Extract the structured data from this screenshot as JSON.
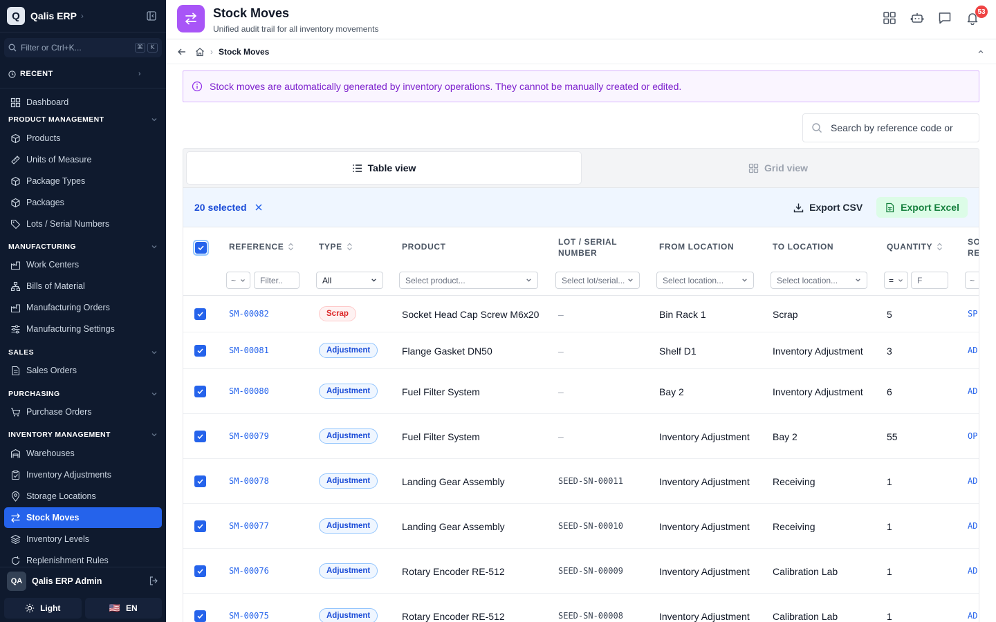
{
  "sidebar": {
    "brand": "Qalis ERP",
    "logo_letter": "Q",
    "search_placeholder": "Filter or Ctrl+K...",
    "kbd": [
      "⌘",
      "K"
    ],
    "recent_label": "RECENT",
    "dashboard": "Dashboard",
    "sections": {
      "product": "PRODUCT MANAGEMENT",
      "manufacturing": "MANUFACTURING",
      "sales": "SALES",
      "purchasing": "PURCHASING",
      "inventory": "INVENTORY MANAGEMENT"
    },
    "items": {
      "products": "Products",
      "uom": "Units of Measure",
      "package_types": "Package Types",
      "packages": "Packages",
      "lots": "Lots / Serial Numbers",
      "work_centers": "Work Centers",
      "bom": "Bills of Material",
      "mo": "Manufacturing Orders",
      "mfg_settings": "Manufacturing Settings",
      "sales_orders": "Sales Orders",
      "purchase_orders": "Purchase Orders",
      "warehouses": "Warehouses",
      "inv_adjustments": "Inventory Adjustments",
      "storage_locations": "Storage Locations",
      "stock_moves": "Stock Moves",
      "inventory_levels": "Inventory Levels",
      "replenishment": "Replenishment Rules"
    },
    "user": {
      "initials": "QA",
      "name": "Qalis ERP Admin"
    },
    "theme_label": "Light",
    "lang_label": "EN",
    "lang_flag": "🇺🇸"
  },
  "header": {
    "title": "Stock Moves",
    "subtitle": "Unified audit trail for all inventory movements",
    "notif_count": "53"
  },
  "breadcrumb": {
    "current": "Stock Moves"
  },
  "info_banner": "Stock moves are automatically generated by inventory operations. They cannot be manually created or edited.",
  "search": {
    "placeholder": "Search by reference code or"
  },
  "tabs": {
    "table": "Table view",
    "grid": "Grid view"
  },
  "selection": {
    "count_label": "20 selected",
    "export_csv": "Export CSV",
    "export_excel": "Export Excel"
  },
  "columns": {
    "reference": "REFERENCE",
    "type": "TYPE",
    "product": "PRODUCT",
    "lot_line1": "LOT / SERIAL",
    "lot_line2": "NUMBER",
    "from": "FROM LOCATION",
    "to": "TO LOCATION",
    "quantity": "QUANTITY",
    "source_line1": "SO",
    "source_line2": "RE"
  },
  "filters": {
    "ref_op": "~",
    "ref_placeholder": "Filter..",
    "type_value": "All",
    "product_placeholder": "Select product...",
    "lot_placeholder": "Select lot/serial...",
    "from_placeholder": "Select location...",
    "to_placeholder": "Select location...",
    "qty_op": "=",
    "qty_value": "F",
    "source_op": "~"
  },
  "rows": [
    {
      "ref": "SM-00082",
      "type": "Scrap",
      "product": "Socket Head Cap Screw M6x20",
      "lot": "–",
      "from": "Bin Rack 1",
      "to": "Scrap",
      "qty": "5",
      "source": "SP"
    },
    {
      "ref": "SM-00081",
      "type": "Adjustment",
      "product": "Flange Gasket DN50",
      "lot": "–",
      "from": "Shelf D1",
      "to": "Inventory Adjustment",
      "qty": "3",
      "source": "AD"
    },
    {
      "ref": "SM-00080",
      "type": "Adjustment",
      "product": "Fuel Filter System",
      "lot": "–",
      "from": "Bay 2",
      "to": "Inventory Adjustment",
      "qty": "6",
      "source": "AD"
    },
    {
      "ref": "SM-00079",
      "type": "Adjustment",
      "product": "Fuel Filter System",
      "lot": "–",
      "from": "Inventory Adjustment",
      "to": "Bay 2",
      "qty": "55",
      "source": "OP"
    },
    {
      "ref": "SM-00078",
      "type": "Adjustment",
      "product": "Landing Gear Assembly",
      "lot": "SEED-SN-00011",
      "from": "Inventory Adjustment",
      "to": "Receiving",
      "qty": "1",
      "source": "AD"
    },
    {
      "ref": "SM-00077",
      "type": "Adjustment",
      "product": "Landing Gear Assembly",
      "lot": "SEED-SN-00010",
      "from": "Inventory Adjustment",
      "to": "Receiving",
      "qty": "1",
      "source": "AD"
    },
    {
      "ref": "SM-00076",
      "type": "Adjustment",
      "product": "Rotary Encoder RE-512",
      "lot": "SEED-SN-00009",
      "from": "Inventory Adjustment",
      "to": "Calibration Lab",
      "qty": "1",
      "source": "AD"
    },
    {
      "ref": "SM-00075",
      "type": "Adjustment",
      "product": "Rotary Encoder RE-512",
      "lot": "SEED-SN-00008",
      "from": "Inventory Adjustment",
      "to": "Calibration Lab",
      "qty": "1",
      "source": "AD"
    }
  ]
}
